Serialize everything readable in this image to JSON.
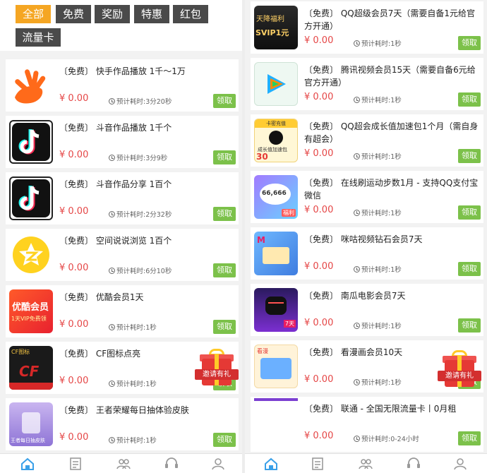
{
  "tabs": [
    "全部",
    "免费",
    "奖励",
    "特惠",
    "红包",
    "流量卡"
  ],
  "left_items": [
    {
      "title": "〔免费〕 快手作品播放 1千～1万",
      "price": "¥ 0.00",
      "time": "预计耗时:3分20秒",
      "button": "领取",
      "thumb": "kuaishou-logo"
    },
    {
      "title": "〔免费〕 斗音作品播放 1千个",
      "price": "¥ 0.00",
      "time": "预计耗时:3分9秒",
      "button": "领取",
      "thumb": "douyin-logo"
    },
    {
      "title": "〔免费〕 斗音作品分享 1百个",
      "price": "¥ 0.00",
      "time": "预计耗时:2分32秒",
      "button": "领取",
      "thumb": "douyin-logo"
    },
    {
      "title": "〔免费〕 空间说说浏览 1百个",
      "price": "¥ 0.00",
      "time": "预计耗时:6分10秒",
      "button": "领取",
      "thumb": "qzone-logo"
    },
    {
      "title": "〔免费〕 优酷会员1天",
      "price": "¥ 0.00",
      "time": "预计耗时:1秒",
      "button": "领取",
      "thumb": "youku-banner",
      "thumb_text": [
        "优酷会员",
        "1天VIP免费领"
      ]
    },
    {
      "title": "〔免费〕 CF图标点亮",
      "price": "¥ 0.00",
      "time": "预计耗时:1秒",
      "button": "领取",
      "thumb": "cf-banner",
      "thumb_text": [
        "CF图标",
        "CF"
      ]
    },
    {
      "title": "〔免费〕 王者荣耀每日抽体验皮肤",
      "price": "¥ 0.00",
      "time": "预计耗时:1秒",
      "button": "领取",
      "thumb": "game-skin-banner",
      "thumb_text": [
        "王者每日抽皮肤"
      ]
    }
  ],
  "right_items": [
    {
      "title": "〔免费〕 QQ超级会员7天（需要自备1元给官方开通）",
      "price": "¥ 0.00",
      "time": "预计耗时:1秒",
      "button": "领取",
      "thumb": "svip-banner",
      "thumb_text": [
        "天降福利",
        "SVIP1元"
      ]
    },
    {
      "title": "〔免费〕 腾讯视频会员15天（需要自备6元给官方开通）",
      "price": "¥ 0.00",
      "time": "预计耗时:1秒",
      "button": "领取",
      "thumb": "tencent-video-logo"
    },
    {
      "title": "〔免费〕 QQ超会成长值加速包1个月（需自身有超会）",
      "price": "¥ 0.00",
      "time": "预计耗时:1秒",
      "button": "领取",
      "thumb": "qq-growth-banner",
      "thumb_text": [
        "卡密充值",
        "成长值加速包",
        "30"
      ]
    },
    {
      "title": "〔免费〕 在线刷运动步数1月 - 支持QQ支付宝微信",
      "price": "¥ 0.00",
      "time": "预计耗时:1秒",
      "button": "领取",
      "thumb": "steps-banner",
      "thumb_text": [
        "66,666",
        "福利"
      ]
    },
    {
      "title": "〔免费〕 咪咕视频钻石会员7天",
      "price": "¥ 0.00",
      "time": "预计耗时:1秒",
      "button": "领取",
      "thumb": "migu-banner",
      "thumb_text": [
        "M"
      ]
    },
    {
      "title": "〔免费〕 南瓜电影会员7天",
      "price": "¥ 0.00",
      "time": "预计耗时:1秒",
      "button": "领取",
      "thumb": "pumpkin-movie-banner",
      "thumb_text": [
        "7天"
      ]
    },
    {
      "title": "〔免费〕 看漫画会员10天",
      "price": "¥ 0.00",
      "time": "预计耗时:1秒",
      "button": "领取",
      "thumb": "comic-banner",
      "thumb_text": [
        "看漫"
      ]
    },
    {
      "title": "〔免费〕 联通 - 全国无限流量卡丨0月租",
      "price": "¥ 0.00",
      "time": "预计耗时:0-24小时",
      "button": "领取",
      "thumb": "none"
    }
  ],
  "gift": {
    "label": "邀请有礼"
  },
  "nav": [
    "home-icon",
    "orders-icon",
    "team-icon",
    "service-icon",
    "profile-icon"
  ],
  "colors": {
    "accent": "#f5a623",
    "price": "#e54646",
    "button": "#7cc14a",
    "tab": "#4a4a4a"
  }
}
